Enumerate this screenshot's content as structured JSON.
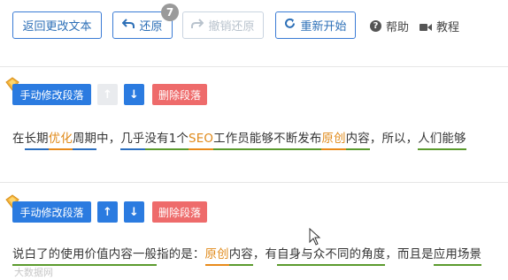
{
  "toolbar": {
    "back_label": "返回更改文本",
    "undo_label": "还原",
    "undo_count": "7",
    "redo_label": "撤销还原",
    "restart_label": "重新开始",
    "help_label": "帮助",
    "tutorial_label": "教程"
  },
  "paragraph1": {
    "edit_label": "手动修改段落",
    "delete_label": "删除段落",
    "segments": [
      "在",
      "长期",
      "优化",
      "周期",
      "中，",
      "几乎",
      "没有",
      "1个",
      "SEO",
      "工作员",
      "能够",
      "不断",
      "发布",
      "原创",
      "内容",
      "，所以，",
      "人们",
      "能够"
    ]
  },
  "paragraph2": {
    "edit_label": "手动修改段落",
    "delete_label": "删除段落",
    "segments": [
      "说白了的",
      "使用价值",
      "内容",
      "一般",
      "指的是：",
      "原创",
      "内容",
      "，有",
      "自身",
      "与众不同的",
      "角度",
      "，而且是",
      "应用场景"
    ]
  },
  "watermark": "大数据网",
  "colors": {
    "accent": "#2b7be0",
    "danger": "#ee6b6b",
    "orange": "#e88a1a",
    "green": "#5b9a2d"
  }
}
